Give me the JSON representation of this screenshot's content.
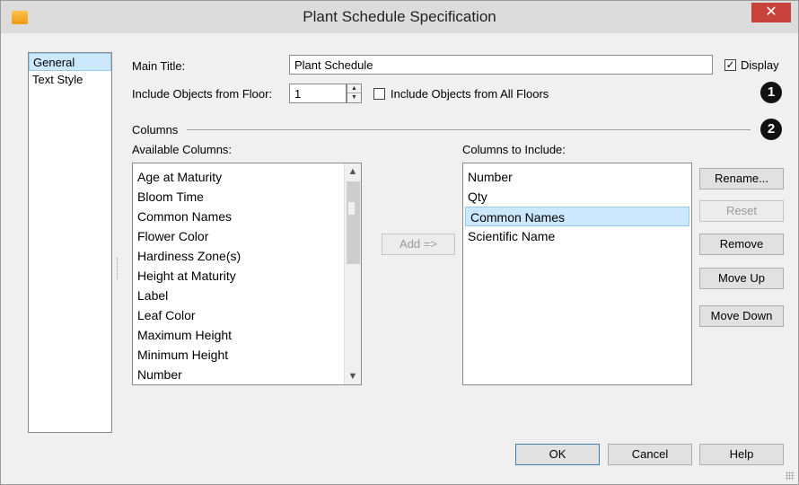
{
  "window": {
    "title": "Plant Schedule Specification",
    "close_glyph": "✕"
  },
  "sidebar": {
    "items": [
      "General",
      "Text Style"
    ],
    "selected": "General"
  },
  "general": {
    "main_title_label": "Main Title:",
    "main_title_value": "Plant Schedule",
    "display_label": "Display",
    "display_checked": true,
    "floor_label": "Include Objects from Floor:",
    "floor_value": "1",
    "all_floors_label": "Include Objects from All Floors",
    "all_floors_checked": false
  },
  "callouts": {
    "first": "1",
    "second": "2"
  },
  "columns": {
    "group_label": "Columns",
    "available_label": "Available Columns:",
    "available": [
      "Age at Maturity",
      "Bloom Time",
      "Common Names",
      "Flower Color",
      "Hardiness Zone(s)",
      "Height at Maturity",
      "Label",
      "Leaf Color",
      "Maximum Height",
      "Minimum Height",
      "Number"
    ],
    "include_label": "Columns to Include:",
    "included": [
      "Number",
      "Qty",
      "Common Names",
      "Scientific Name"
    ],
    "included_selected": "Common Names",
    "add_button": "Add =>",
    "rename_button": "Rename...",
    "reset_button": "Reset",
    "remove_button": "Remove",
    "move_up_button": "Move Up",
    "move_down_button": "Move Down"
  },
  "footer": {
    "ok": "OK",
    "cancel": "Cancel",
    "help": "Help"
  },
  "colors": {
    "selection": "#cce8ff",
    "selection_border": "#99c9f0",
    "close_button": "#c7423b",
    "dialog_bg": "#f0f0f0"
  },
  "icons": {
    "app": "app-icon",
    "close": "close-icon",
    "checkmark": "checkmark-icon",
    "spin_up": "spin-up-icon",
    "spin_down": "spin-down-icon",
    "scroll_up": "scroll-up-icon",
    "scroll_down": "scroll-down-icon",
    "resize_grip": "resize-grip-icon"
  }
}
